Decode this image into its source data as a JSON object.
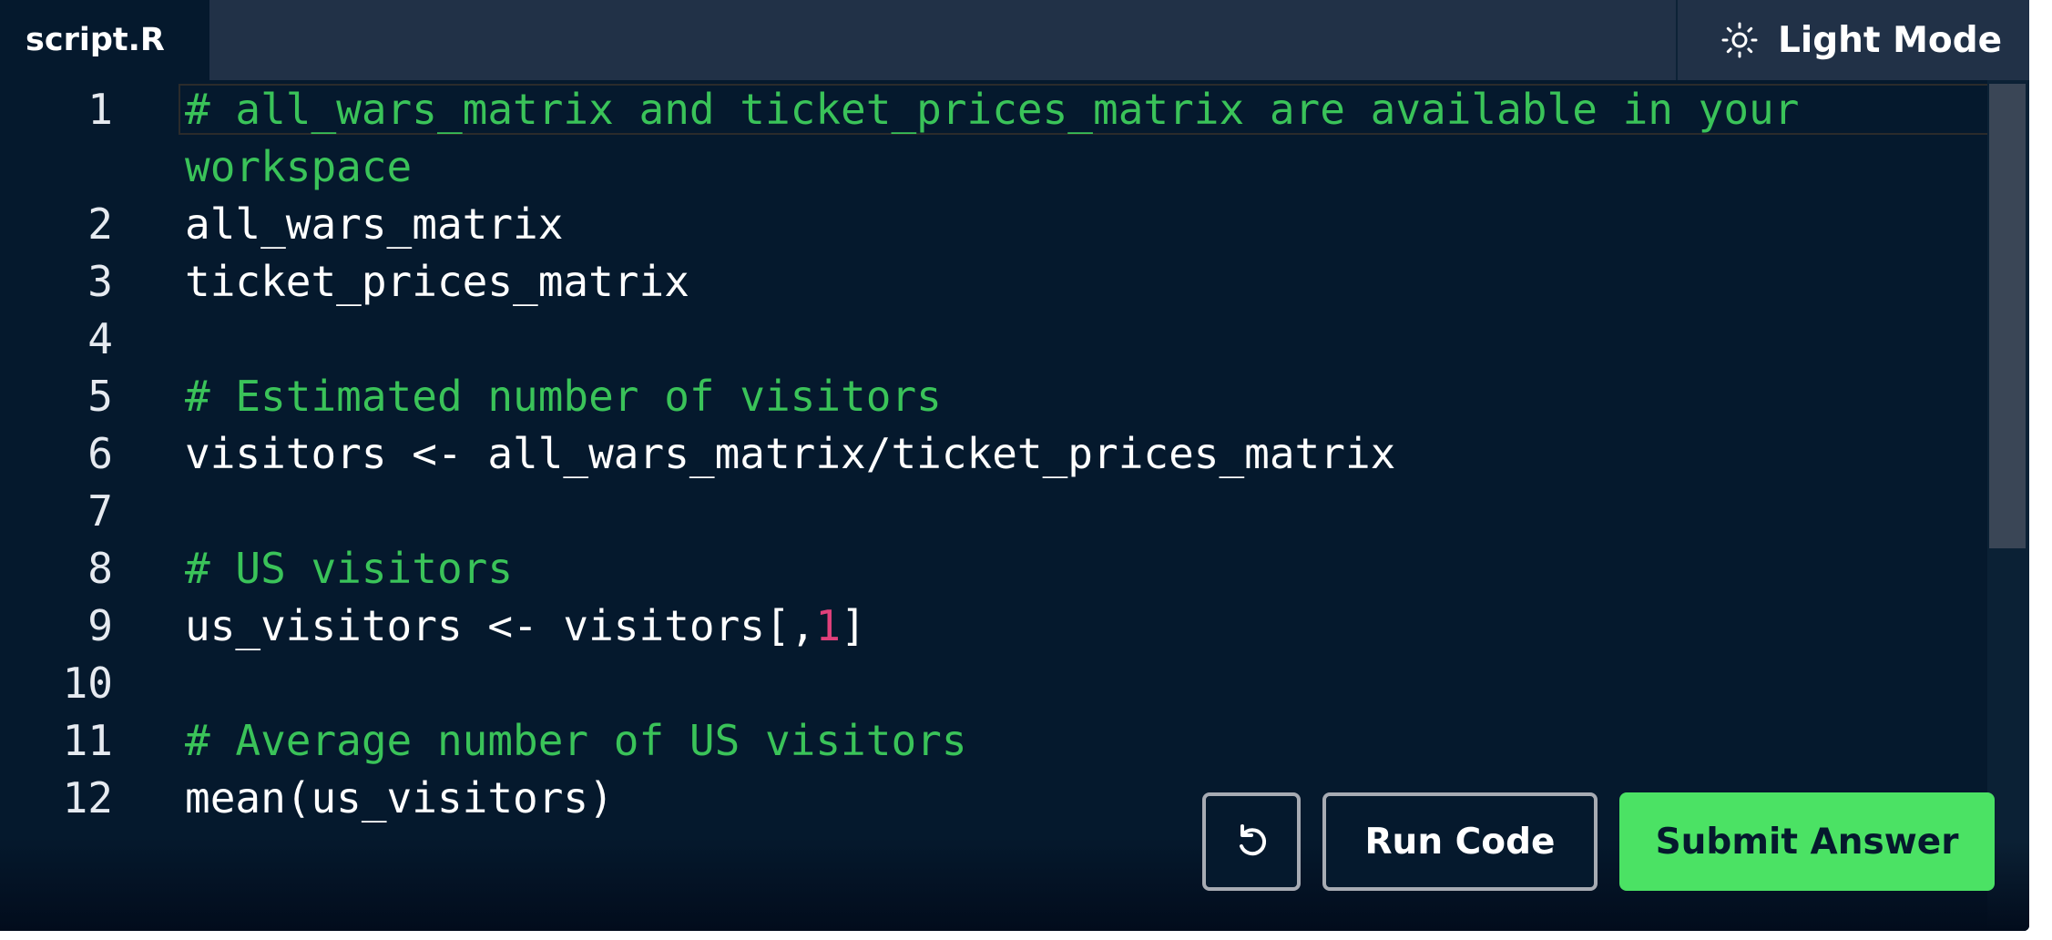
{
  "tab": {
    "label": "script.R"
  },
  "mode_toggle": {
    "label": "Light Mode",
    "icon": "sun-icon"
  },
  "code": {
    "lines": [
      {
        "number": "1",
        "segments": [
          {
            "text": "# all_wars_matrix and ticket_prices_matrix are available in your",
            "kind": "comment"
          }
        ]
      },
      {
        "number": "",
        "segments": [
          {
            "text": "workspace",
            "kind": "comment"
          }
        ]
      },
      {
        "number": "2",
        "segments": [
          {
            "text": "all_wars_matrix",
            "kind": "code"
          }
        ]
      },
      {
        "number": "3",
        "segments": [
          {
            "text": "ticket_prices_matrix",
            "kind": "code"
          }
        ]
      },
      {
        "number": "4",
        "segments": []
      },
      {
        "number": "5",
        "segments": [
          {
            "text": "# Estimated number of visitors",
            "kind": "comment"
          }
        ]
      },
      {
        "number": "6",
        "segments": [
          {
            "text": "visitors <- all_wars_matrix/ticket_prices_matrix",
            "kind": "code"
          }
        ]
      },
      {
        "number": "7",
        "segments": []
      },
      {
        "number": "8",
        "segments": [
          {
            "text": "# US visitors",
            "kind": "comment"
          }
        ]
      },
      {
        "number": "9",
        "segments": [
          {
            "text": "us_visitors <- visitors[,",
            "kind": "code"
          },
          {
            "text": "1",
            "kind": "number"
          },
          {
            "text": "]",
            "kind": "code"
          }
        ]
      },
      {
        "number": "10",
        "segments": []
      },
      {
        "number": "11",
        "segments": [
          {
            "text": "# Average number of US visitors",
            "kind": "comment"
          }
        ]
      },
      {
        "number": "12",
        "segments": [
          {
            "text": "mean(us_visitors)",
            "kind": "code"
          }
        ]
      }
    ]
  },
  "buttons": {
    "reset_icon": "reset-icon",
    "run_label": "Run Code",
    "submit_label": "Submit Answer"
  },
  "colors": {
    "background": "#05192d",
    "comment": "#3ac359",
    "number": "#e0407a",
    "submit": "#4be264"
  }
}
